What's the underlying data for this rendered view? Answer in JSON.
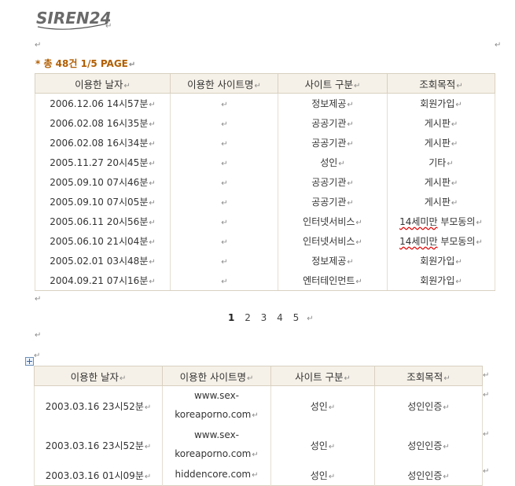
{
  "brand": {
    "logo_text": "SIREN24"
  },
  "paragraph_mark": "↵",
  "summary": "* 총 48건 1/5 PAGE",
  "table1": {
    "headers": [
      "이용한 날자",
      "이용한 사이트명",
      "사이트 구분",
      "조회목적"
    ],
    "rows": [
      {
        "date": "2006.12.06 14시57분",
        "site": "",
        "category": "정보제공",
        "purpose": "회원가입"
      },
      {
        "date": "2006.02.08 16시35분",
        "site": "",
        "category": "공공기관",
        "purpose": "게시판"
      },
      {
        "date": "2006.02.08 16시34분",
        "site": "",
        "category": "공공기관",
        "purpose": "게시판"
      },
      {
        "date": "2005.11.27 20시45분",
        "site": "",
        "category": "성인",
        "purpose": "기타"
      },
      {
        "date": "2005.09.10 07시46분",
        "site": "",
        "category": "공공기관",
        "purpose": "게시판"
      },
      {
        "date": "2005.09.10 07시05분",
        "site": "",
        "category": "공공기관",
        "purpose": "게시판"
      },
      {
        "date": "2005.06.11 20시56분",
        "site": "",
        "category": "인터넷서비스",
        "purpose_a": "14세미만",
        "purpose_b": " 부모동의"
      },
      {
        "date": "2005.06.10 21시04분",
        "site": "",
        "category": "인터넷서비스",
        "purpose_a": "14세미만",
        "purpose_b": " 부모동의"
      },
      {
        "date": "2005.02.01 03시48분",
        "site": "",
        "category": "정보제공",
        "purpose": "회원가입"
      },
      {
        "date": "2004.09.21 07시16분",
        "site": "",
        "category": "엔터테인먼트",
        "purpose": "회원가입"
      }
    ]
  },
  "pagination": [
    "1",
    "2",
    "3",
    "4",
    "5"
  ],
  "table2": {
    "headers": [
      "이용한 날자",
      "이용한 사이트명",
      "사이트 구분",
      "조회목적"
    ],
    "rows": [
      {
        "date": "2003.03.16 23시52분",
        "site_a": "www.sex-",
        "site_b": "koreaporno.com",
        "category": "성인",
        "purpose": "성인인증"
      },
      {
        "date": "2003.03.16 23시52분",
        "site_a": "www.sex-",
        "site_b": "koreaporno.com",
        "category": "성인",
        "purpose": "성인인증"
      },
      {
        "date": "2003.03.16 01시09분",
        "site_a": "hiddencore.com",
        "category": "성인",
        "purpose": "성인인증"
      }
    ]
  }
}
